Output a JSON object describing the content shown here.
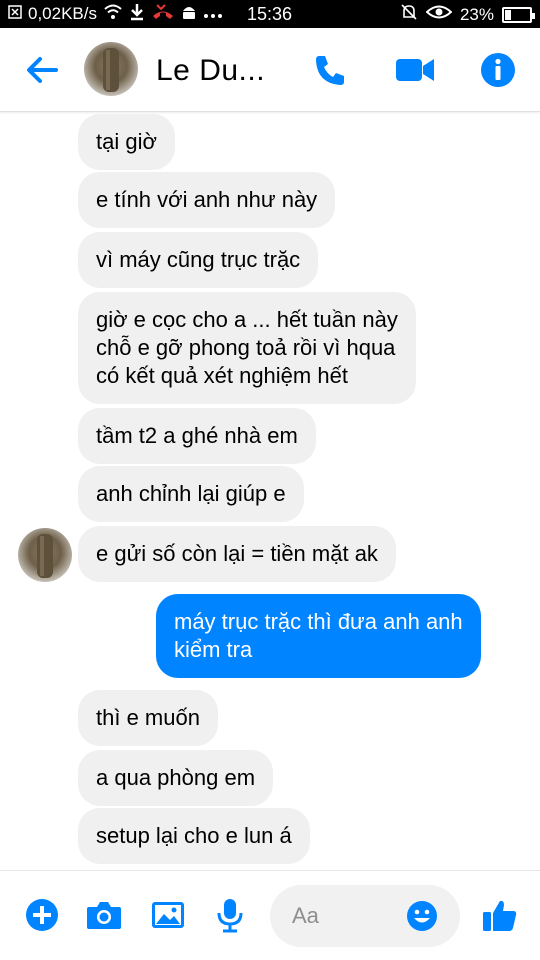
{
  "status_bar": {
    "net_speed": "0,02KB/s",
    "time": "15:36",
    "battery": "23%",
    "battery_level": 0.23,
    "icons": [
      "notification-x-icon",
      "wifi-icon",
      "download-icon",
      "missed-call-icon",
      "android-icon",
      "more-dots-icon",
      "alarm-off-icon",
      "eye-icon",
      "battery-icon"
    ]
  },
  "header": {
    "contact_name": "Le Du...",
    "icons": [
      "back-arrow-icon",
      "phone-icon",
      "video-icon",
      "info-icon"
    ],
    "accent": "#0084ff"
  },
  "messages": [
    {
      "from": "them",
      "text": "tại giờ"
    },
    {
      "from": "them",
      "text": "e tính với anh như này"
    },
    {
      "from": "them",
      "text": "vì máy cũng trục trặc"
    },
    {
      "from": "them",
      "text": "giờ e cọc cho a ... hết tuần này\nchỗ e gỡ phong toả rồi vì hqua\ncó kết quả xét nghiệm hết"
    },
    {
      "from": "them",
      "text": "tầm t2 a ghé nhà em"
    },
    {
      "from": "them",
      "text": "anh chỉnh lại giúp e"
    },
    {
      "from": "them",
      "text": "e gửi số còn lại = tiền mặt ak"
    },
    {
      "from": "me",
      "text": "máy trục trặc thì đưa anh anh\nkiểm tra"
    },
    {
      "from": "them",
      "text": "thì e muốn"
    },
    {
      "from": "them",
      "text": "a qua phòng em"
    },
    {
      "from": "them",
      "text": "setup lại cho e lun á"
    }
  ],
  "composer": {
    "placeholder": "Aa",
    "icons": [
      "plus-icon",
      "camera-icon",
      "gallery-icon",
      "mic-icon",
      "emoji-icon",
      "like-icon"
    ]
  },
  "colors": {
    "accent": "#0084ff",
    "incoming_bubble": "#f0f0f0",
    "outgoing_bubble": "#0084ff"
  }
}
